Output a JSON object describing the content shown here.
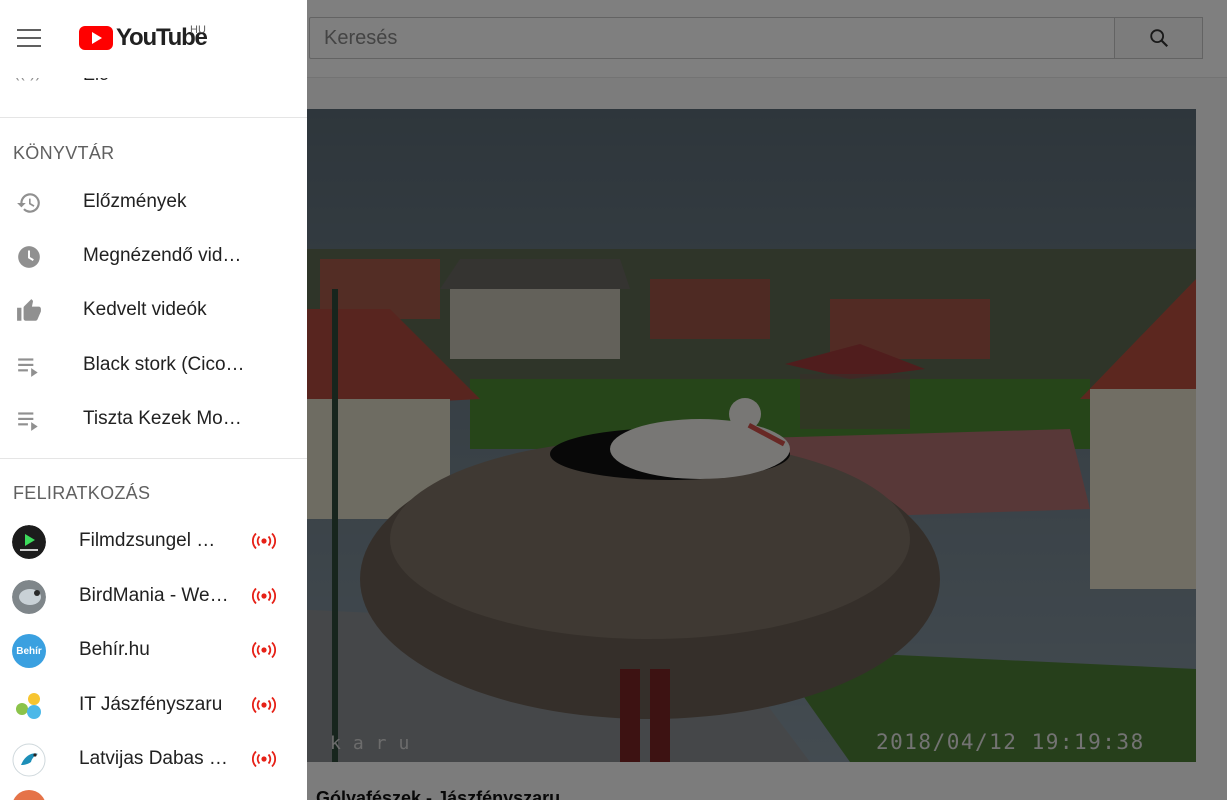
{
  "header": {
    "logo_text": "YouTube",
    "country_code": "HU",
    "search_placeholder": "Keresés"
  },
  "drawer": {
    "clipped_item": {
      "label": "Élő",
      "icon": "live-icon"
    },
    "library": {
      "title": "KÖNYVTÁR",
      "items": [
        {
          "label": "Előzmények",
          "icon": "history-icon"
        },
        {
          "label": "Megnézendő vid…",
          "icon": "clock-icon"
        },
        {
          "label": "Kedvelt videók",
          "icon": "thumb-up-icon"
        },
        {
          "label": "Black stork (Cico…",
          "icon": "playlist-icon"
        },
        {
          "label": "Tiszta Kezek Mo…",
          "icon": "playlist-icon"
        }
      ]
    },
    "subscriptions": {
      "title": "FELIRATKOZÁS",
      "items": [
        {
          "label": "Filmdzsungel …",
          "live": true,
          "avatar_color": "#1c1c1c",
          "accent": "#3ddc5c"
        },
        {
          "label": "BirdMania - We…",
          "live": true,
          "avatar_color": "#7f868a",
          "accent": "#c9d1d6"
        },
        {
          "label": "Behír.hu",
          "live": true,
          "avatar_color": "#3aa0e0",
          "accent": "#ffffff",
          "avatar_text": "Behír"
        },
        {
          "label": "IT Jászfényszaru",
          "live": true,
          "avatar_color": "#ffffff",
          "accent": "#4cb8e8"
        },
        {
          "label": "Latvijas Dabas …",
          "live": true,
          "avatar_color": "#ffffff",
          "accent": "#1d8fb8"
        }
      ]
    }
  },
  "video": {
    "timestamp": "2018/04/12  19:19:38",
    "watermark": "karu"
  },
  "below_video_title": "Gólyafészek - Jászfényszaru",
  "colors": {
    "brand_red": "#ff0000",
    "live_red": "#e62117",
    "scrim": "rgba(0,0,0,0.5)"
  }
}
